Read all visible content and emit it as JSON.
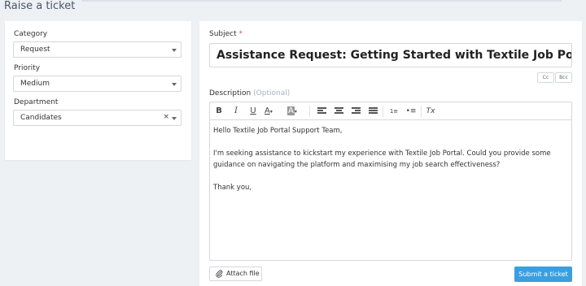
{
  "page": {
    "title": "Raise a ticket"
  },
  "left": {
    "category": {
      "label": "Category",
      "value": "Request"
    },
    "priority": {
      "label": "Priority",
      "value": "Medium"
    },
    "department": {
      "label": "Department",
      "value": "Candidates",
      "clear": "×"
    }
  },
  "right": {
    "subject": {
      "label": "Subject",
      "required_mark": "*",
      "value": "Assistance Request: Getting Started with Textile Job Portal"
    },
    "cc_label": "Cc",
    "bcc_label": "Bcc",
    "description": {
      "label": "Description",
      "optional_text": "(Optional)",
      "toolbar": {
        "bold": "B",
        "italic": "I",
        "underline": "U",
        "font_color": "A",
        "bg_color": "A",
        "clear_format": "Tx"
      },
      "paragraphs": [
        "Hello Textile Job Portal Support Team,",
        "I'm seeking assistance to kickstart my experience with Textile Job Portal. Could you provide some guidance on navigating the platform and maximising my job search effectiveness?",
        "Thank you,"
      ]
    },
    "attach_label": "Attach file",
    "submit_label": "Submit a ticket"
  },
  "colors": {
    "accent": "#3a9fe0",
    "required": "#d9534f",
    "background": "#eef1f4"
  }
}
